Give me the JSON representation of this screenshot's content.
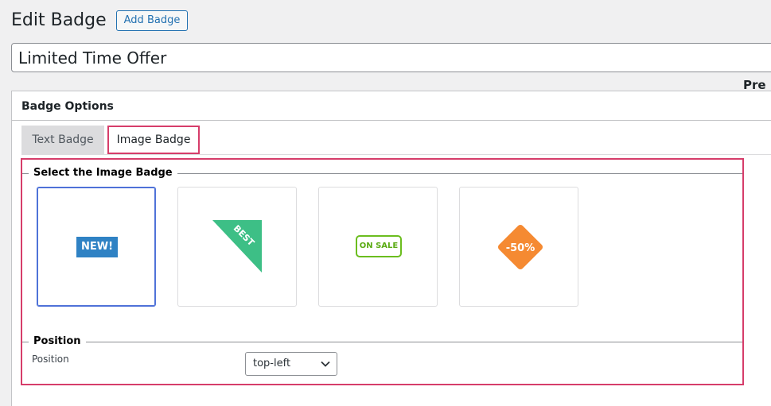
{
  "header": {
    "title": "Edit Badge",
    "add_button": "Add Badge"
  },
  "badge_title": {
    "value": "Limited Time Offer"
  },
  "options": {
    "heading": "Badge Options",
    "tabs": [
      {
        "label": "Text Badge",
        "active": false
      },
      {
        "label": "Image Badge",
        "active": true
      }
    ],
    "select_section": "Select the Image Badge",
    "badges": [
      {
        "label": "NEW!",
        "selected": true,
        "color": "#2f82c4"
      },
      {
        "label": "BEST",
        "selected": false,
        "color": "#3dbf86"
      },
      {
        "label": "ON SALE",
        "selected": false,
        "color": "#6bbd1e"
      },
      {
        "label": "-50%",
        "selected": false,
        "color": "#f58a32"
      }
    ],
    "position_section": "Position",
    "position_label": "Position",
    "position_value": "top-left",
    "preview_label": "Pre"
  },
  "colors": {
    "accent": "#2271b1",
    "highlight_frame": "#d63d6a",
    "selected_card": "#4f72d8"
  }
}
